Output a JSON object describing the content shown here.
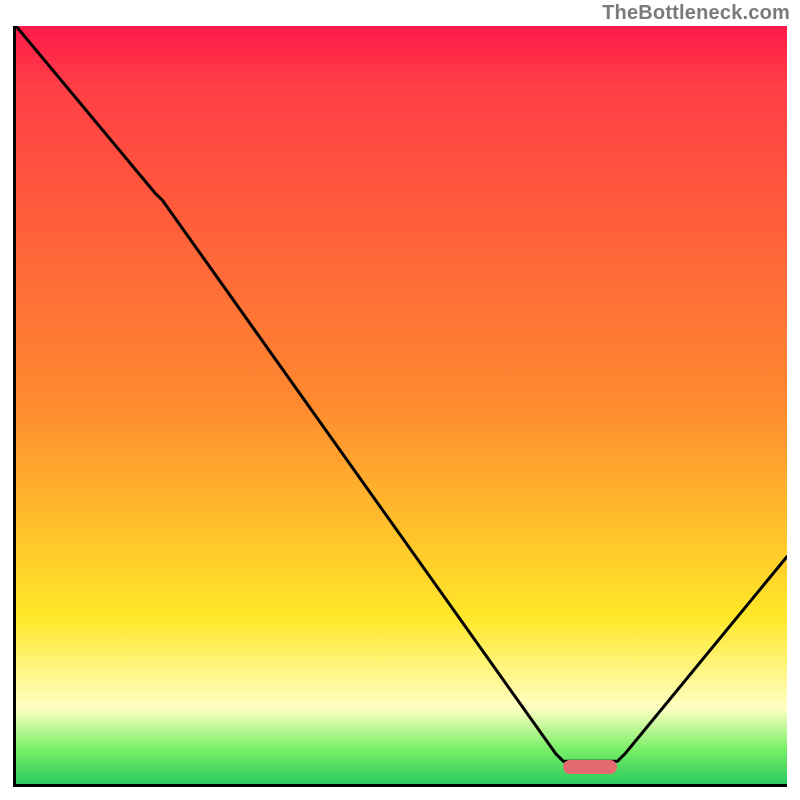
{
  "attribution": "TheBottleneck.com",
  "colors": {
    "top_red": "#ff1a4b",
    "mid_red": "#ff3e45",
    "orange": "#ff8a2f",
    "yellow": "#ffe829",
    "pale_yellow": "#ffffc3",
    "lime": "#77ef66",
    "green": "#2ac961",
    "marker": "#e46a6f",
    "axis": "#000000",
    "curve": "#000000"
  },
  "chart_data": {
    "type": "line",
    "title": "",
    "xlabel": "",
    "ylabel": "",
    "xlim": [
      0,
      100
    ],
    "ylim": [
      0,
      100
    ],
    "x": [
      0,
      18,
      19,
      70,
      71,
      78,
      79,
      100
    ],
    "values": [
      100,
      78,
      77,
      4,
      3,
      3,
      4,
      30
    ],
    "marker": {
      "x_start": 71,
      "x_end": 78,
      "y": 2.3
    },
    "gradient_stops": [
      {
        "pos": 0.0,
        "color": "#ff1a4b"
      },
      {
        "pos": 0.08,
        "color": "#ff3e45"
      },
      {
        "pos": 0.5,
        "color": "#ff8a2f"
      },
      {
        "pos": 0.78,
        "color": "#ffe829"
      },
      {
        "pos": 0.9,
        "color": "#ffffc3"
      },
      {
        "pos": 0.955,
        "color": "#77ef66"
      },
      {
        "pos": 1.0,
        "color": "#2ac961"
      }
    ]
  }
}
